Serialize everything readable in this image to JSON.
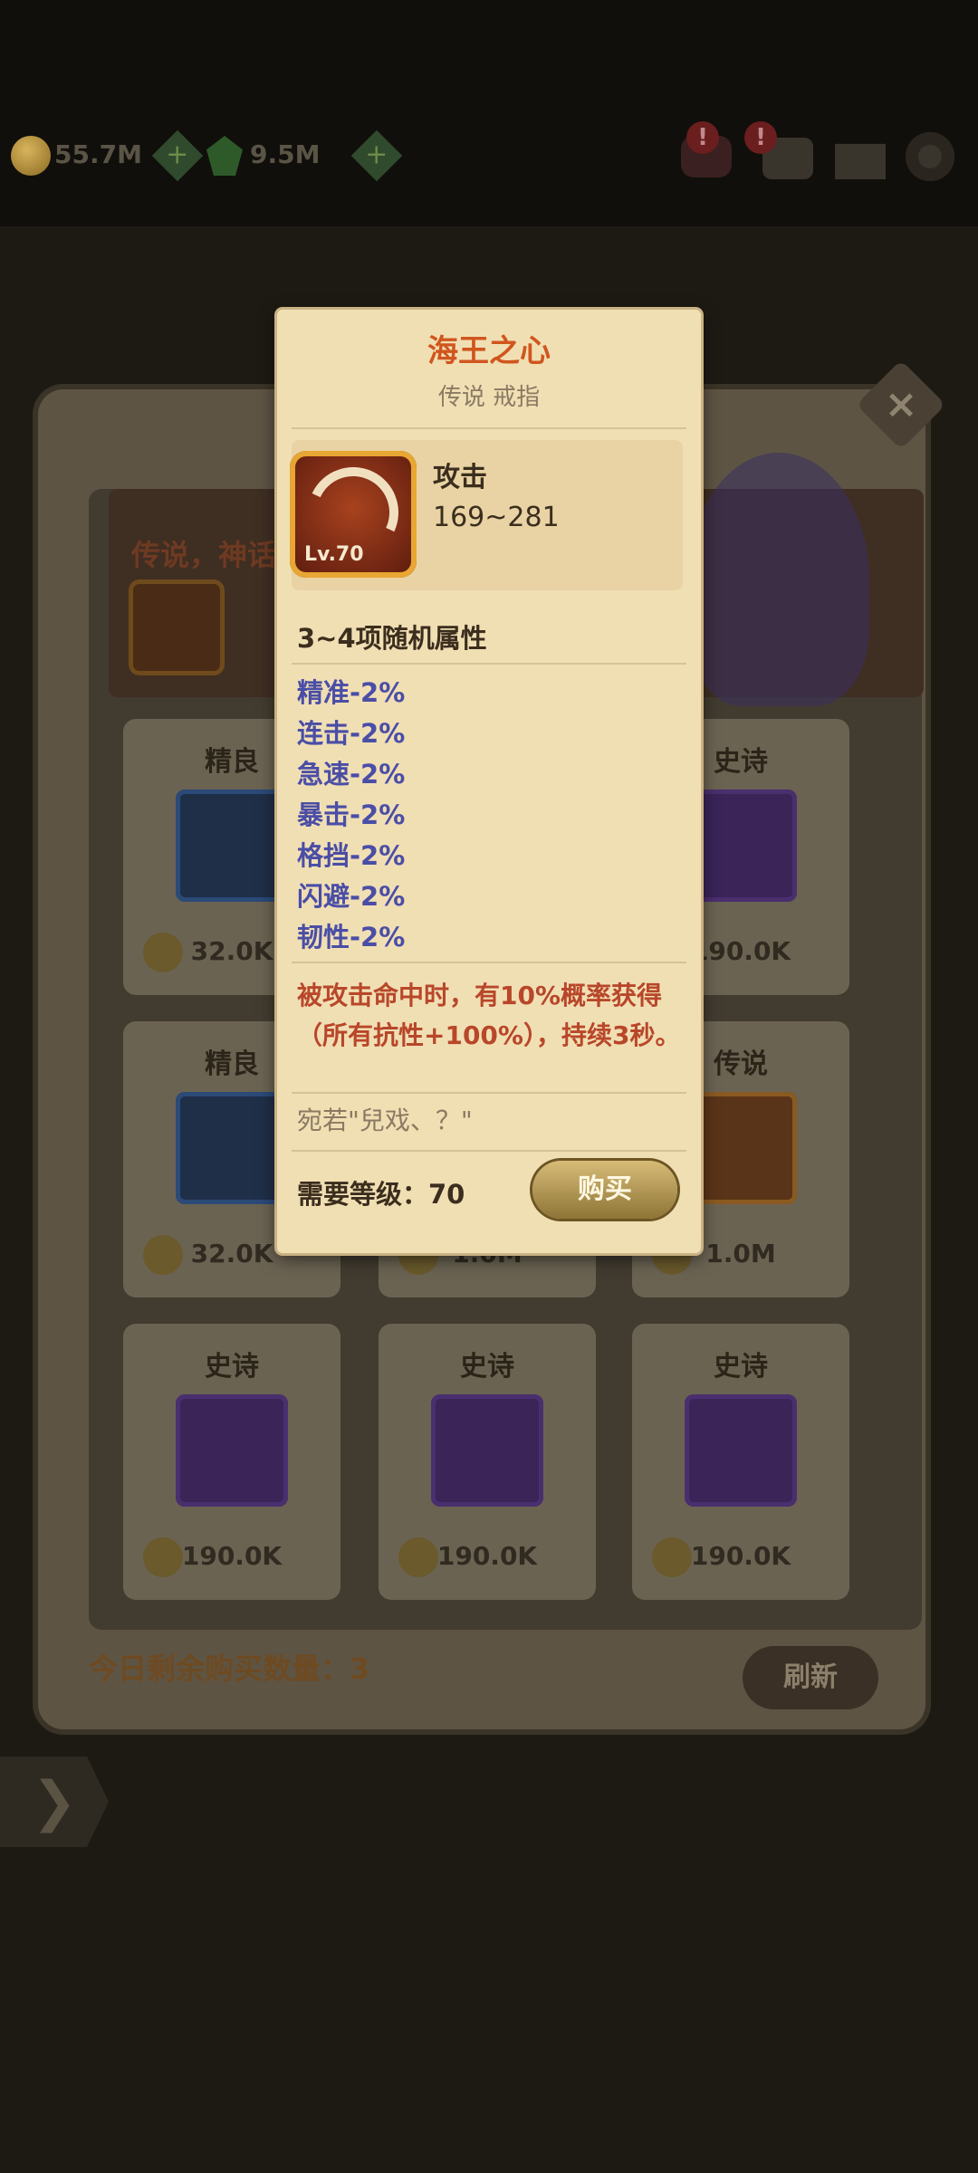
{
  "topbar": {
    "gold": "55.7M",
    "gems": "9.5M",
    "badge_1": "!",
    "badge_2": "!"
  },
  "shop": {
    "banner_text": "传说，神话",
    "remaining_label": "今日剩余购买数量：3",
    "refresh_label": "刷新",
    "close_label": "×",
    "back_label": "❯",
    "cards": [
      {
        "rarity": "精良",
        "price": "32.0K"
      },
      {
        "rarity": "史诗",
        "price": "190.0K"
      },
      {
        "rarity": "精良",
        "price": "32.0K"
      },
      {
        "rarity": "",
        "price": "1.0M"
      },
      {
        "rarity": "传说",
        "price": "1.0M"
      },
      {
        "rarity": "史诗",
        "price": "190.0K"
      },
      {
        "rarity": "史诗",
        "price": "190.0K"
      },
      {
        "rarity": "史诗",
        "price": "190.0K"
      }
    ]
  },
  "tooltip": {
    "title": "海王之心",
    "subtitle": "传说 戒指",
    "item_level": "Lv.70",
    "stat_name": "攻击",
    "stat_value": "169~281",
    "random_attr_title": "3~4项随机属性",
    "attributes": [
      "精准-2%",
      "连击-2%",
      "急速-2%",
      "暴击-2%",
      "格挡-2%",
      "闪避-2%",
      "韧性-2%"
    ],
    "effect_text": "被攻击命中时，有10%概率获得（所有抗性+100%），持续3秒。",
    "flavor_text": "宛若\"兒戏、？\"",
    "required_level": "需要等级：70",
    "buy_label": "购买"
  }
}
